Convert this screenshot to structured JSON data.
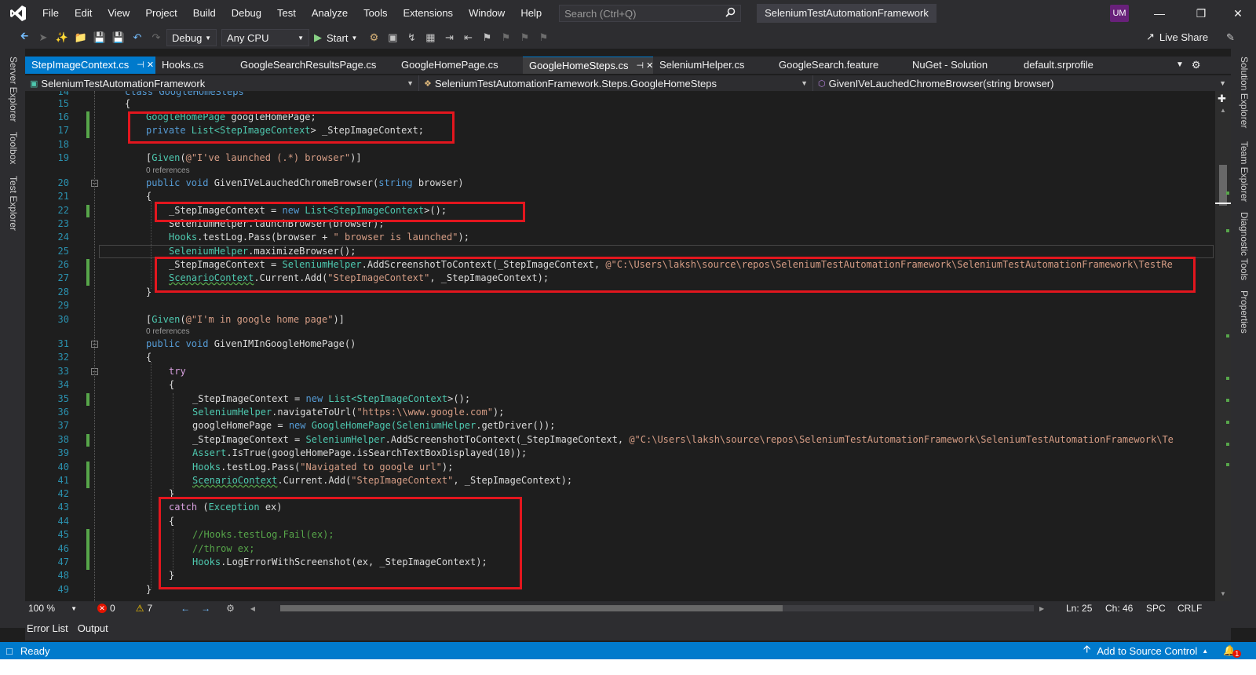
{
  "menubar": {
    "items": [
      "File",
      "Edit",
      "View",
      "Project",
      "Build",
      "Debug",
      "Test",
      "Analyze",
      "Tools",
      "Extensions",
      "Window",
      "Help"
    ],
    "search_placeholder": "Search (Ctrl+Q)",
    "solution_title": "SeleniumTestAutomationFramework",
    "avatar_initials": "UM"
  },
  "toolbar": {
    "config": "Debug",
    "platform": "Any CPU",
    "start_label": "Start",
    "live_share": "Live Share"
  },
  "side_left": [
    "Server Explorer",
    "Toolbox",
    "Test Explorer"
  ],
  "side_right": [
    "Solution Explorer",
    "Team Explorer",
    "Diagnostic Tools",
    "Properties"
  ],
  "doc_tabs": [
    {
      "label": "StepImageContext.cs",
      "extra": "⊣ ✕",
      "state": "active"
    },
    {
      "label": "Hooks.cs",
      "extra": "",
      "state": ""
    },
    {
      "label": "GoogleSearchResultsPage.cs",
      "extra": "",
      "state": ""
    },
    {
      "label": "GoogleHomePage.cs",
      "extra": "",
      "state": ""
    },
    {
      "label": "GoogleHomeSteps.cs",
      "extra": "⊣ ✕",
      "state": "open"
    },
    {
      "label": "SeleniumHelper.cs",
      "extra": "",
      "state": ""
    },
    {
      "label": "GoogleSearch.feature",
      "extra": "",
      "state": ""
    },
    {
      "label": "NuGet - Solution",
      "extra": "",
      "state": ""
    },
    {
      "label": "default.srprofile",
      "extra": "",
      "state": ""
    }
  ],
  "navbar": {
    "project": "SeleniumTestAutomationFramework",
    "class_scope": "SeleniumTestAutomationFramework.Steps.GoogleHomeSteps",
    "member": "GivenIVeLauchedChromeBrowser(string browser)"
  },
  "code": {
    "codelens_given1": "0 references",
    "codelens_given2": "0 references",
    "lines": {
      "l14": "class GoogleHomeSteps",
      "l16_a": "GoogleHomePage",
      "l16_b": " googleHomePage;",
      "l17_a": "private",
      "l17_b": " List<",
      "l17_c": "StepImageContext",
      "l17_d": "> _StepImageContext;",
      "l19_a": "[",
      "l19_b": "Given",
      "l19_c": "(",
      "l19_d": "@\"I've launched (.*) browser\"",
      "l19_e": ")]",
      "l20_a": "public void",
      "l20_b": " GivenIVeLauchedChromeBrowser(",
      "l20_c": "string",
      "l20_d": " browser)",
      "l22_a": "_StepImageContext = ",
      "l22_b": "new",
      "l22_c": " List<",
      "l22_d": "StepImageContext",
      "l22_e": ">();",
      "l23": "SeleniumHelper.launchBrowser(browser);",
      "l24_a": "Hooks",
      "l24_b": ".testLog.Pass(browser + ",
      "l24_c": "\" browser is launched\"",
      "l24_d": ");",
      "l25_a": "SeleniumHelper",
      "l25_b": ".maximizeBrowser();",
      "l26_a": "_StepImageContext = ",
      "l26_b": "SeleniumHelper",
      "l26_c": ".AddScreenshotToContext(_StepImageContext, ",
      "l26_d": "@\"C:\\Users\\laksh\\source\\repos\\SeleniumTestAutomationFramework\\SeleniumTestAutomationFramework\\TestRe",
      "l27_a": "ScenarioContext",
      "l27_b": ".Current.Add(",
      "l27_c": "\"StepImageContext\"",
      "l27_d": ", _StepImageContext);",
      "l30_a": "[",
      "l30_b": "Given",
      "l30_c": "(",
      "l30_d": "@\"I'm in google home page\"",
      "l30_e": ")]",
      "l31_a": "public void",
      "l31_b": " GivenIMInGoogleHomePage()",
      "l33": "try",
      "l35_a": "_StepImageContext = ",
      "l35_b": "new",
      "l35_c": " List<",
      "l35_d": "StepImageContext",
      "l35_e": ">();",
      "l36_a": "SeleniumHelper",
      "l36_b": ".navigateToUrl(",
      "l36_c": "\"https:\\\\www.google.com\"",
      "l36_d": ");",
      "l37_a": "googleHomePage = ",
      "l37_b": "new",
      "l37_c": " GoogleHomePage(",
      "l37_d": "SeleniumHelper",
      "l37_e": ".getDriver());",
      "l38_a": "_StepImageContext = ",
      "l38_b": "SeleniumHelper",
      "l38_c": ".AddScreenshotToContext(_StepImageContext, ",
      "l38_d": "@\"C:\\Users\\laksh\\source\\repos\\SeleniumTestAutomationFramework\\SeleniumTestAutomationFramework\\Te",
      "l39_a": "Assert",
      "l39_b": ".IsTrue(googleHomePage.isSearchTextBoxDisplayed(10));",
      "l40_a": "Hooks",
      "l40_b": ".testLog.Pass(",
      "l40_c": "\"Navigated to google url\"",
      "l40_d": ");",
      "l41_a": "ScenarioContext",
      "l41_b": ".Current.Add(",
      "l41_c": "\"StepImageContext\"",
      "l41_d": ", _StepImageContext);",
      "l43_a": "catch",
      "l43_b": " (",
      "l43_c": "Exception",
      "l43_d": " ex)",
      "l45": "//Hooks.testLog.Fail(ex);",
      "l46": "//throw ex;",
      "l47_a": "Hooks",
      "l47_b": ".LogErrorWithScreenshot(ex, _StepImageContext);"
    }
  },
  "editor_status": {
    "zoom": "100 %",
    "errors": "0",
    "warnings": "7",
    "ln": "Ln: 25",
    "ch": "Ch: 46",
    "spc": "SPC",
    "crlf": "CRLF"
  },
  "bottom_tabs": [
    "Error List",
    "Output"
  ],
  "statusbar": {
    "ready": "Ready",
    "source_control": "Add to Source Control",
    "notification_count": "1"
  },
  "colors": {
    "accent": "#007acc",
    "highlight_box": "#e3161e",
    "keyword": "#569cd6",
    "type": "#4ec9b0",
    "string": "#d69d85",
    "comment": "#57a64a"
  }
}
